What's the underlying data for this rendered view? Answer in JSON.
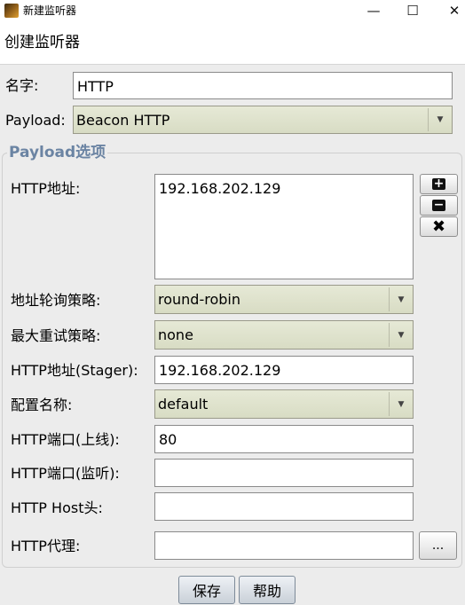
{
  "window": {
    "title": "新建监听器",
    "minimize": "—",
    "maximize": "☐",
    "close": "✕"
  },
  "header": {
    "title": "创建监听器"
  },
  "form": {
    "name_label": "名字:",
    "name_value": "HTTP",
    "payload_label": "Payload:",
    "payload_value": "Beacon HTTP"
  },
  "options": {
    "group_title": "Payload选项",
    "http_hosts_label": "HTTP地址:",
    "http_hosts_value": "192.168.202.129",
    "rotation_label": "地址轮询策略:",
    "rotation_value": "round-robin",
    "failover_label": "最大重试策略:",
    "failover_value": "none",
    "stager_label": "HTTP地址(Stager):",
    "stager_value": "192.168.202.129",
    "profile_label": "配置名称:",
    "profile_value": "default",
    "port_c2_label": "HTTP端口(上线):",
    "port_c2_value": "80",
    "port_bind_label": "HTTP端口(监听):",
    "port_bind_value": "",
    "host_header_label": "HTTP Host头:",
    "host_header_value": "",
    "proxy_label": "HTTP代理:",
    "proxy_value": "",
    "proxy_button": "..."
  },
  "side_buttons": {
    "add": "+",
    "remove": "−",
    "clear": "✖"
  },
  "buttons": {
    "save": "保存",
    "help": "帮助"
  }
}
